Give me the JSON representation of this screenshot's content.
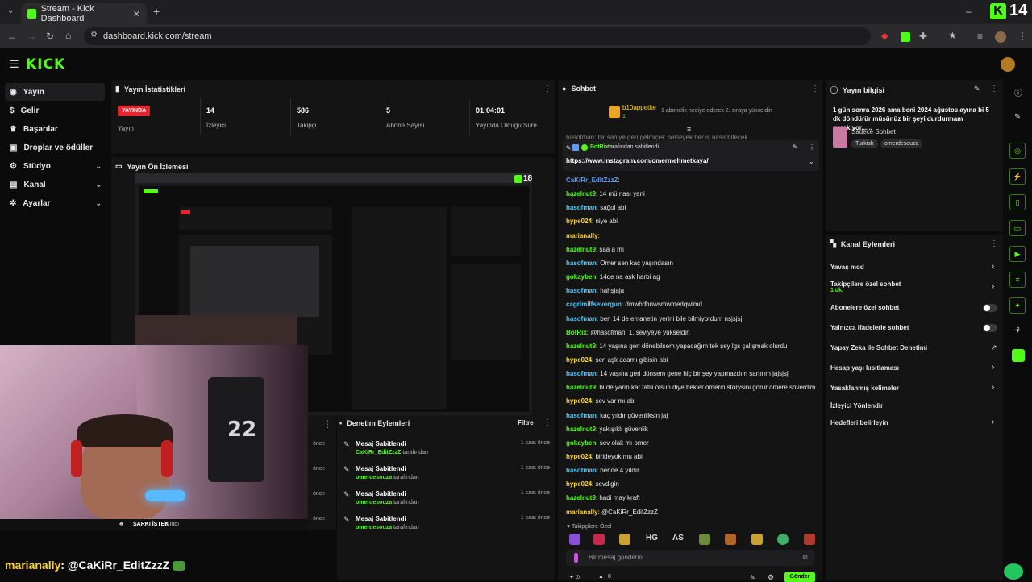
{
  "browser": {
    "tab_title": "Stream - Kick Dashboard",
    "url": "dashboard.kick.com/stream",
    "corner_badge": "14"
  },
  "header": {
    "logo": "KICK"
  },
  "sidebar": {
    "items": [
      {
        "label": "Yayın",
        "icon": "broadcast-icon"
      },
      {
        "label": "Gelir",
        "icon": "dollar-icon"
      },
      {
        "label": "Başarılar",
        "icon": "trophy-icon"
      },
      {
        "label": "Droplar ve ödüller",
        "icon": "gift-icon"
      },
      {
        "label": "Stüdyo",
        "icon": "gear-icon"
      },
      {
        "label": "Kanal",
        "icon": "layers-icon"
      },
      {
        "label": "Ayarlar",
        "icon": "settings-icon"
      }
    ]
  },
  "stats": {
    "title": "Yayın İstatistikleri",
    "live_badge": "YAYINDA",
    "live_label": "Yayın",
    "viewers": "14",
    "viewers_label": "İzleyici",
    "followers": "586",
    "followers_label": "Takipçi",
    "subs": "5",
    "subs_label": "Abone Sayısı",
    "uptime": "01:04:01",
    "uptime_label": "Yayında Olduğu Süre"
  },
  "preview": {
    "title": "Yayın Ön İzlemesi",
    "viewer_count": "18"
  },
  "overlay": {
    "chat_user": "marianally",
    "chat_text": ": @CaKiRr_EditZzzZ",
    "alert_title": "ŞARKI İSTEK",
    "alert_suffix": "alındı"
  },
  "mod_actions": {
    "title": "Denetim Eylemleri",
    "filter_label": "Filtre",
    "rows": [
      {
        "title": "Mesaj Sabitlendi",
        "user": "CaKiRr_EditZzzZ",
        "suffix": "tarafından",
        "time": "1 saat önce"
      },
      {
        "title": "Mesaj Sabitlendi",
        "user": "omerdesouza",
        "suffix": "tarafından",
        "time": "1 saat önce"
      },
      {
        "title": "Mesaj Sabitlendi",
        "user": "omerdesouza",
        "suffix": "tarafından",
        "time": "1 saat önce"
      },
      {
        "title": "Mesaj Sabitlendi",
        "user": "omerdesouza",
        "suffix": "tarafından",
        "time": "1 saat önce"
      }
    ],
    "side_times": [
      "önce",
      "önce",
      "önce",
      "önce"
    ]
  },
  "chat": {
    "title": "Sohbet",
    "gift_user": "b10appetite",
    "gift_count": "1",
    "gift_text": "1 abonelik hediye ederek 2. sıraya yükseldin",
    "pinned_by": "BotRix",
    "pinned_suffix": "tarafından sabitlendi",
    "pinned_link": "https://www.instagram.com/omermehmetkaya/",
    "cutoff_line": "hasofman: bir saniye geri gelmiçek bekleyek her iş nasıl bitecek",
    "messages": [
      {
        "user": "CaKiRr_EditZzzZ",
        "color": "#5a9df5",
        "text": ""
      },
      {
        "user": "hazelnut9",
        "color": "#53fc18",
        "text": "14 mü nası yani"
      },
      {
        "user": "hasofman",
        "color": "#5ac8f5",
        "text": "sağol abi"
      },
      {
        "user": "hype024",
        "color": "#ffd426",
        "text": "niye abi"
      },
      {
        "user": "marianally",
        "color": "#ffd426",
        "text": ""
      },
      {
        "user": "hazelnut9",
        "color": "#53fc18",
        "text": "şaa a mı"
      },
      {
        "user": "hasofman",
        "color": "#5ac8f5",
        "text": "Ömer sen kaç yaşındasın"
      },
      {
        "user": "gokayben",
        "color": "#53fc18",
        "text": "14de na aşk harbi ag"
      },
      {
        "user": "hasofman",
        "color": "#5ac8f5",
        "text": "hahşjaja"
      },
      {
        "user": "cagrimilfsevergun",
        "color": "#5ac8f5",
        "text": "dmwbdhnwsmwmedqwimd"
      },
      {
        "user": "hasofman",
        "color": "#5ac8f5",
        "text": "ben 14 de emanetin yerini bile bilmiyordum nsjsjsj"
      },
      {
        "user": "BotRix",
        "color": "#53fc18",
        "text": "@hasofman, 1. seviyeye yükseldin"
      },
      {
        "user": "hazelnut9",
        "color": "#53fc18",
        "text": "14 yaşına geri dönebilsem yapacağım tek şey lgs çalışmak olurdu"
      },
      {
        "user": "hype024",
        "color": "#ffd426",
        "text": "sen aşk adamı gibisin abi"
      },
      {
        "user": "hasofman",
        "color": "#5ac8f5",
        "text": "14 yaşına geri dönsem gene hiç bir şey yapmazdım sanırım jajsjsj"
      },
      {
        "user": "hazelnut9",
        "color": "#53fc18",
        "text": "bi de yarın kar tatili olsun diye bekler ömerin storysini görür ömere söverdim"
      },
      {
        "user": "hype024",
        "color": "#ffd426",
        "text": "sev var mı abi"
      },
      {
        "user": "hasofman",
        "color": "#5ac8f5",
        "text": "kaç yıldır güvenliksin jaj"
      },
      {
        "user": "hazelnut9",
        "color": "#53fc18",
        "text": "yakışıklı güvenlik"
      },
      {
        "user": "gokayben",
        "color": "#53fc18",
        "text": "sev olak mı omer"
      },
      {
        "user": "hype024",
        "color": "#ffd426",
        "text": "birideyok mu abi"
      },
      {
        "user": "hasofman",
        "color": "#5ac8f5",
        "text": "bende 4 yıldır"
      },
      {
        "user": "hype024",
        "color": "#ffd426",
        "text": "sevdigin"
      },
      {
        "user": "hazelnut9",
        "color": "#53fc18",
        "text": "hadi may kraft"
      },
      {
        "user": "marianally",
        "color": "#ffd426",
        "text": "@CaKiRr_EditZzzZ"
      }
    ],
    "followers_only": "Takipçilere Özel",
    "input_placeholder": "Bir mesaj gönderin",
    "send_label": "Gönder",
    "bottom_count": "0"
  },
  "stream_info": {
    "title": "Yayın bilgisi",
    "description": "1 gün sonra 2026 ama beni 2024 ağustos ayına bi 5 dk döndürür müsünüz bir şeyi durdurmam gerekiyor......",
    "category": "Sadece Sohbet",
    "tags": [
      "Turkish",
      "omerdesouza"
    ]
  },
  "channel_actions": {
    "title": "Kanal Eylemleri",
    "items": [
      {
        "label": "Yavaş mod",
        "control": "chevron"
      },
      {
        "label": "Takipçilere özel sohbet",
        "sub": "1 dk.",
        "control": "chevron"
      },
      {
        "label": "Abonelere özel sohbet",
        "control": "toggle"
      },
      {
        "label": "Yalnızca ifadelerle sohbet",
        "control": "toggle"
      },
      {
        "label": "Yapay Zeka ile Sohbet Denetimi",
        "control": "external"
      },
      {
        "label": "Hesap yaşı kısıtlaması",
        "control": "chevron"
      },
      {
        "label": "Yasaklanmış kelimeler",
        "control": "chevron"
      },
      {
        "label": "İzleyici Yönlendir",
        "control": "none"
      },
      {
        "label": "Hedefleri belirleyin",
        "control": "chevron"
      }
    ]
  }
}
